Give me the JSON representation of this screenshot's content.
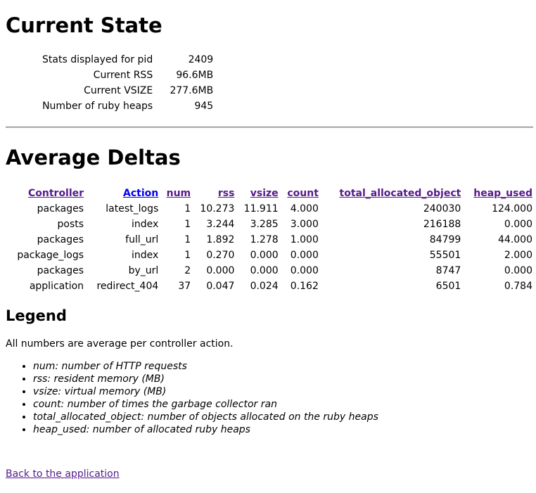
{
  "current_state": {
    "title": "Current State",
    "rows": [
      {
        "label": "Stats displayed for pid",
        "value": "2409"
      },
      {
        "label": "Current RSS",
        "value": "96.6MB"
      },
      {
        "label": "Current VSIZE",
        "value": "277.6MB"
      },
      {
        "label": "Number of ruby heaps",
        "value": "945"
      }
    ]
  },
  "average_deltas": {
    "title": "Average Deltas",
    "headers": [
      "Controller",
      "Action",
      "num",
      "rss",
      "vsize",
      "count",
      "total_allocated_object",
      "heap_used"
    ],
    "rows": [
      [
        "packages",
        "latest_logs",
        "1",
        "10.273",
        "11.911",
        "4.000",
        "240030",
        "124.000"
      ],
      [
        "posts",
        "index",
        "1",
        "3.244",
        "3.285",
        "3.000",
        "216188",
        "0.000"
      ],
      [
        "packages",
        "full_url",
        "1",
        "1.892",
        "1.278",
        "1.000",
        "84799",
        "44.000"
      ],
      [
        "package_logs",
        "index",
        "1",
        "0.270",
        "0.000",
        "0.000",
        "55501",
        "2.000"
      ],
      [
        "packages",
        "by_url",
        "2",
        "0.000",
        "0.000",
        "0.000",
        "8747",
        "0.000"
      ],
      [
        "application",
        "redirect_404",
        "37",
        "0.047",
        "0.024",
        "0.162",
        "6501",
        "0.784"
      ]
    ]
  },
  "legend": {
    "title": "Legend",
    "note": "All numbers are average per controller action.",
    "items": [
      "num: number of HTTP requests",
      "rss: resident memory (MB)",
      "vsize: virtual memory (MB)",
      "count: number of times the garbage collector ran",
      "total_allocated_object: number of objects allocated on the ruby heaps",
      "heap_used: number of allocated ruby heaps"
    ]
  },
  "back_link": "Back to the application",
  "colors": {
    "link": "#0000ee",
    "visited": "#551a8b"
  }
}
